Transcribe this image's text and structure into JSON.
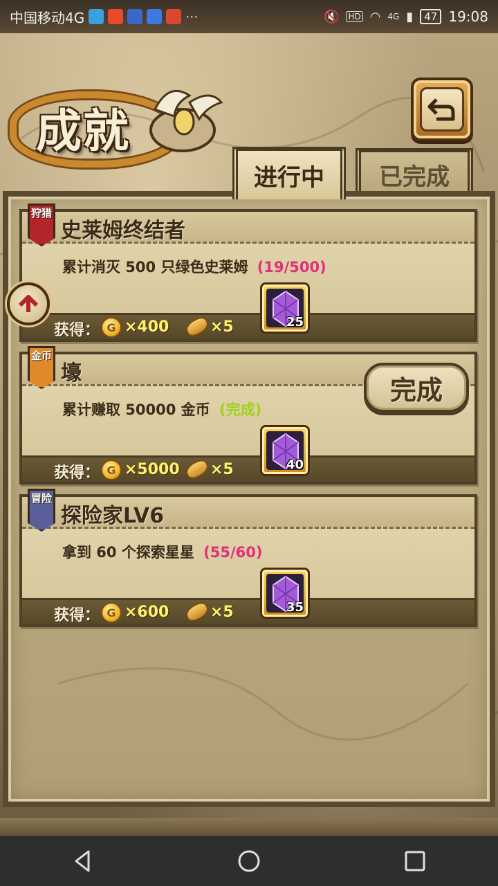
{
  "status_bar": {
    "carrier": "中国移动4G",
    "network": "4G",
    "battery": "47",
    "time": "19:08"
  },
  "header": {
    "title": "成就"
  },
  "tabs": [
    {
      "label": "进行中",
      "active": true
    },
    {
      "label": "已完成",
      "active": false
    }
  ],
  "achievements": [
    {
      "category": "狩猎",
      "category_color": "#b3242b",
      "name": "史莱姆终结者",
      "description": "累计消灭 500 只绿色史莱姆",
      "progress": "(19/500)",
      "progress_color": "#e0307a",
      "reward_label": "获得：",
      "coins": "×400",
      "bread": "×5",
      "gems": "25",
      "completed": false
    },
    {
      "category": "金币",
      "category_color": "#e0892a",
      "name": "壕",
      "description": "累计赚取 50000 金币",
      "progress": "(完成)",
      "progress_color": "#9ed21e",
      "reward_label": "获得：",
      "coins": "×5000",
      "bread": "×5",
      "gems": "40",
      "completed": true,
      "complete_button": "完成"
    },
    {
      "category": "冒险",
      "category_color": "#5a5f9c",
      "name": "探险家LV6",
      "description": "拿到 60 个探索星星",
      "progress": "(55/60)",
      "progress_color": "#e0307a",
      "reward_label": "获得：",
      "coins": "×600",
      "bread": "×5",
      "gems": "35",
      "completed": false
    }
  ],
  "icons": {
    "back": "back-arrow-icon",
    "side": "side-menu-icon",
    "coin_letter": "G"
  },
  "colors": {
    "reward_value": "#fff36a",
    "panel": "#c4b289",
    "gold": "#d48b16"
  }
}
